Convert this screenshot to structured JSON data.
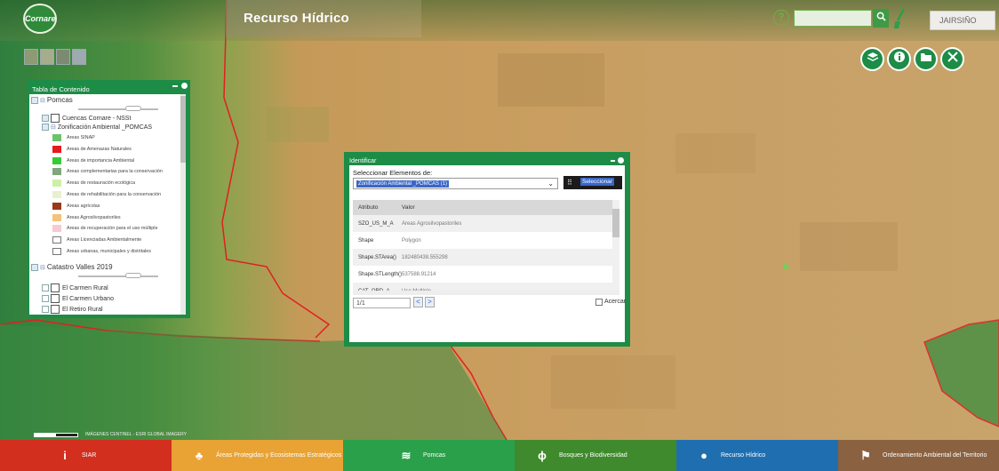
{
  "header": {
    "logo_text": "Cornare",
    "app_title": "Recurso Hídrico",
    "help_label": "?",
    "search": {
      "value": "",
      "placeholder": ""
    },
    "user_label": "JAIRSIÑO"
  },
  "colors": {
    "brand_green": "#1c8c46",
    "selection_blue": "#3a67c7",
    "boundary_red": "#e02020"
  },
  "icons": {
    "map_tools": [
      "layers-icon",
      "info-icon",
      "folder-icon",
      "tools-icon"
    ],
    "search": "search-icon",
    "brush": "brush-icon"
  },
  "toc": {
    "title": "Tabla de Contenido",
    "group1": "Pomcas",
    "layer_nsst": "Cuencas Cornare - NSSt",
    "layer_zonif": "Zonificación Ambiental _POMCAS",
    "legend": [
      {
        "label": "Areas SINAP",
        "color": "#6cc36a"
      },
      {
        "label": "Areas de Amenazas Naturales",
        "color": "#e81a1a"
      },
      {
        "label": "Areas de importancia Ambiental",
        "color": "#33cc33"
      },
      {
        "label": "Areas complementarias para la conservación",
        "color": "#7fa87a"
      },
      {
        "label": "Areas de restauración ecológica",
        "color": "#ccf0a8"
      },
      {
        "label": "Areas de rehabilitación para la conservación",
        "color": "#e7f1cf"
      },
      {
        "label": "Areas agrícolas",
        "color": "#993a1a"
      },
      {
        "label": "Areas Agrosilvopastoriles",
        "color": "#f4c27a"
      },
      {
        "label": "Areas de recuperación para el uso múltiple",
        "color": "#f7c9d3"
      },
      {
        "label": "Areas Licenciadas Ambientalmente",
        "color": "#ffffff"
      },
      {
        "label": "Areas urbanas, municipales y distritales",
        "color": "#ffffff"
      }
    ],
    "group2": "Catastro Valles 2019",
    "catastro_items": [
      "El Carmen Rural",
      "El Carmen Urbano",
      "El Retiro Rural"
    ]
  },
  "identify": {
    "title": "Identificar",
    "select_label": "Seleccionar Elementos de:",
    "selected_layer": "Zonificación Ambiental _POMCAS (1)",
    "select_button": "Seleccionar",
    "columns": [
      "Atributo",
      "Valor"
    ],
    "rows": [
      {
        "attr": "SZO_US_M_A",
        "value": "Areas Agrosilvopastoriles"
      },
      {
        "attr": "Shape",
        "value": "Polygon"
      },
      {
        "attr": "Shape.STArea()",
        "value": "182480438.555298"
      },
      {
        "attr": "Shape.STLength()",
        "value": "537588.91214"
      },
      {
        "attr": "CAT_ORD_A",
        "value": "Uso Multiple"
      }
    ],
    "page": "1/1",
    "prev": "<",
    "next": ">",
    "zoom_label": "Acercar"
  },
  "bottom_nav": [
    {
      "label": "SIAR",
      "color": "#d22f1f",
      "icon": "siar-icon",
      "glyph": "i"
    },
    {
      "label": "Áreas Protegidas y Ecosistemas Estratégicos",
      "color": "#e8a334",
      "icon": "trees-icon",
      "glyph": "♣"
    },
    {
      "label": "Pomcas",
      "color": "#2aa04a",
      "icon": "pomcas-icon",
      "glyph": "≋"
    },
    {
      "label": "Bosques y Biodiversidad",
      "color": "#3f8a2c",
      "icon": "leaf-icon",
      "glyph": "ϕ"
    },
    {
      "label": "Recurso Hídrico",
      "color": "#1f6fb0",
      "icon": "water-drop-icon",
      "glyph": "●"
    },
    {
      "label": "Ordenamiento Ambiental del Territorio",
      "color": "#8a6241",
      "icon": "territory-icon",
      "glyph": "⚑"
    }
  ],
  "map": {
    "attribution": "IMÁGENES CENTINEL - ESRI GLOBAL IMAGERY"
  }
}
